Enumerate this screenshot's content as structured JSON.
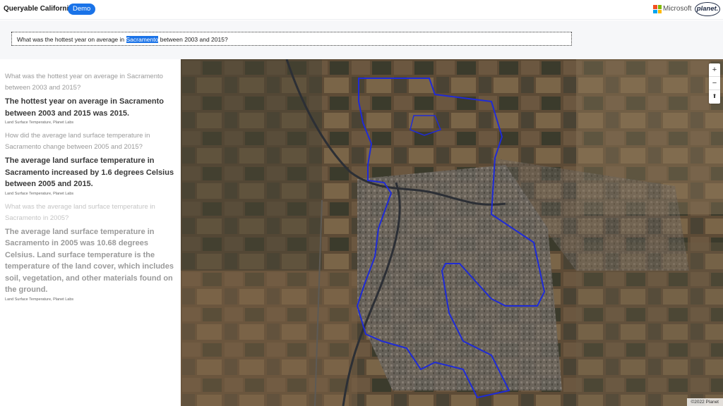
{
  "header": {
    "app_title": "Queryable California",
    "badge": "Demo",
    "microsoft_label": "Microsoft",
    "planet_label": "planet.",
    "colors": {
      "badge": "#1a73e8",
      "ms_red": "#f25022",
      "ms_green": "#7fba00",
      "ms_blue": "#00a4ef",
      "ms_yellow": "#ffb900"
    }
  },
  "query": {
    "before": "What was the hottest year on average in ",
    "highlight": "Sacramento",
    "after": " between 2003 and 2015?"
  },
  "conversation": [
    {
      "question": "What was the hottest year on average in Sacramento between 2003 and 2015?",
      "answer": "The hottest year on average in Sacramento between 2003 and 2015 was 2015.",
      "source": "Land Surface Temperature, Planet Labs"
    },
    {
      "question": "How did the average land surface temperature in Sacramento change between 2005 and 2015?",
      "answer": "The average land surface temperature in Sacramento increased by 1.6 degrees Celsius between 2005 and 2015.",
      "source": "Land Surface Temperature, Planet Labs"
    },
    {
      "question": "What was the average land surface temperature in Sacramento in 2005?",
      "answer": "The average land surface temperature in Sacramento in 2005 was 10.68 degrees Celsius. Land surface temperature is the temperature of the land cover, which includes soil, vegetation, and other materials found on the ground.",
      "source": "Land Surface Temperature, Planet Labs"
    }
  ],
  "map": {
    "zoom_in": "+",
    "zoom_out": "−",
    "compass": "⬆",
    "attribution": "©2022 Planet",
    "boundary_color": "#1f2bd6",
    "river_color": "#2c2f35"
  }
}
